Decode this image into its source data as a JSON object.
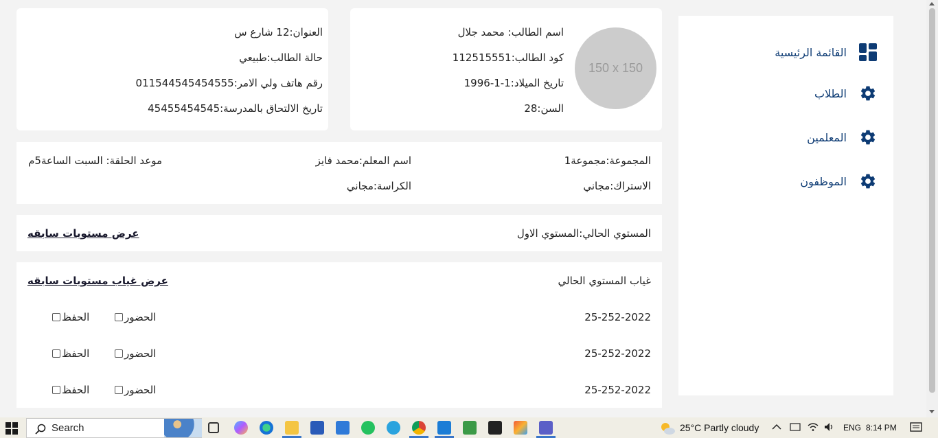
{
  "sidebar": {
    "items": [
      {
        "label": "القائمة الرئيسية",
        "icon": "dashboard-icon"
      },
      {
        "label": "الطلاب",
        "icon": "gear-icon"
      },
      {
        "label": "المعلمين",
        "icon": "gear-icon"
      },
      {
        "label": "الموظفون",
        "icon": "gear-icon"
      }
    ]
  },
  "student": {
    "avatar_text": "150 x 150",
    "name": "اسم الطالب: محمد جلال",
    "code": "كود الطالب:112515551",
    "birth_date": "تاريخ الميلاد:1-1-1996",
    "age": "السن:28"
  },
  "contact": {
    "address": "العنوان:12 شارع س",
    "status": "حالة الطالب:طبيعي",
    "guardian_phone": "رقم هاتف ولي الامر:011544545454555",
    "enroll_date": "تاريخ الالتحاق بالمدرسة:45455454545"
  },
  "group": {
    "group_name": "المجموعة:مجموعة1",
    "teacher": "اسم المعلم:محمد فايز",
    "session_time": "موعد الحلقة: السبت الساعة5م",
    "subscription": "الاستراك:مجاني",
    "notebook": "الكراسة:مجاني"
  },
  "level": {
    "current": "المستوي الحالي:المستوي الاول",
    "previous_link": "عرض مستويات سابقه"
  },
  "absence": {
    "title": "غياب المستوي الحالي",
    "previous_link": "عرض غياب مستويات سابقه",
    "attendance_label": "الحضور",
    "memorization_label": "الحفظ",
    "rows": [
      {
        "date": "25-252-2022"
      },
      {
        "date": "25-252-2022"
      },
      {
        "date": "25-252-2022"
      }
    ]
  },
  "taskbar": {
    "search_placeholder": "Search",
    "weather": "25°C  Partly cloudy",
    "language": "ENG",
    "time": "8:14 PM"
  },
  "colors": {
    "accent": "#0d3b74",
    "background": "#f3f3f3",
    "avatar": "#cccccc"
  }
}
